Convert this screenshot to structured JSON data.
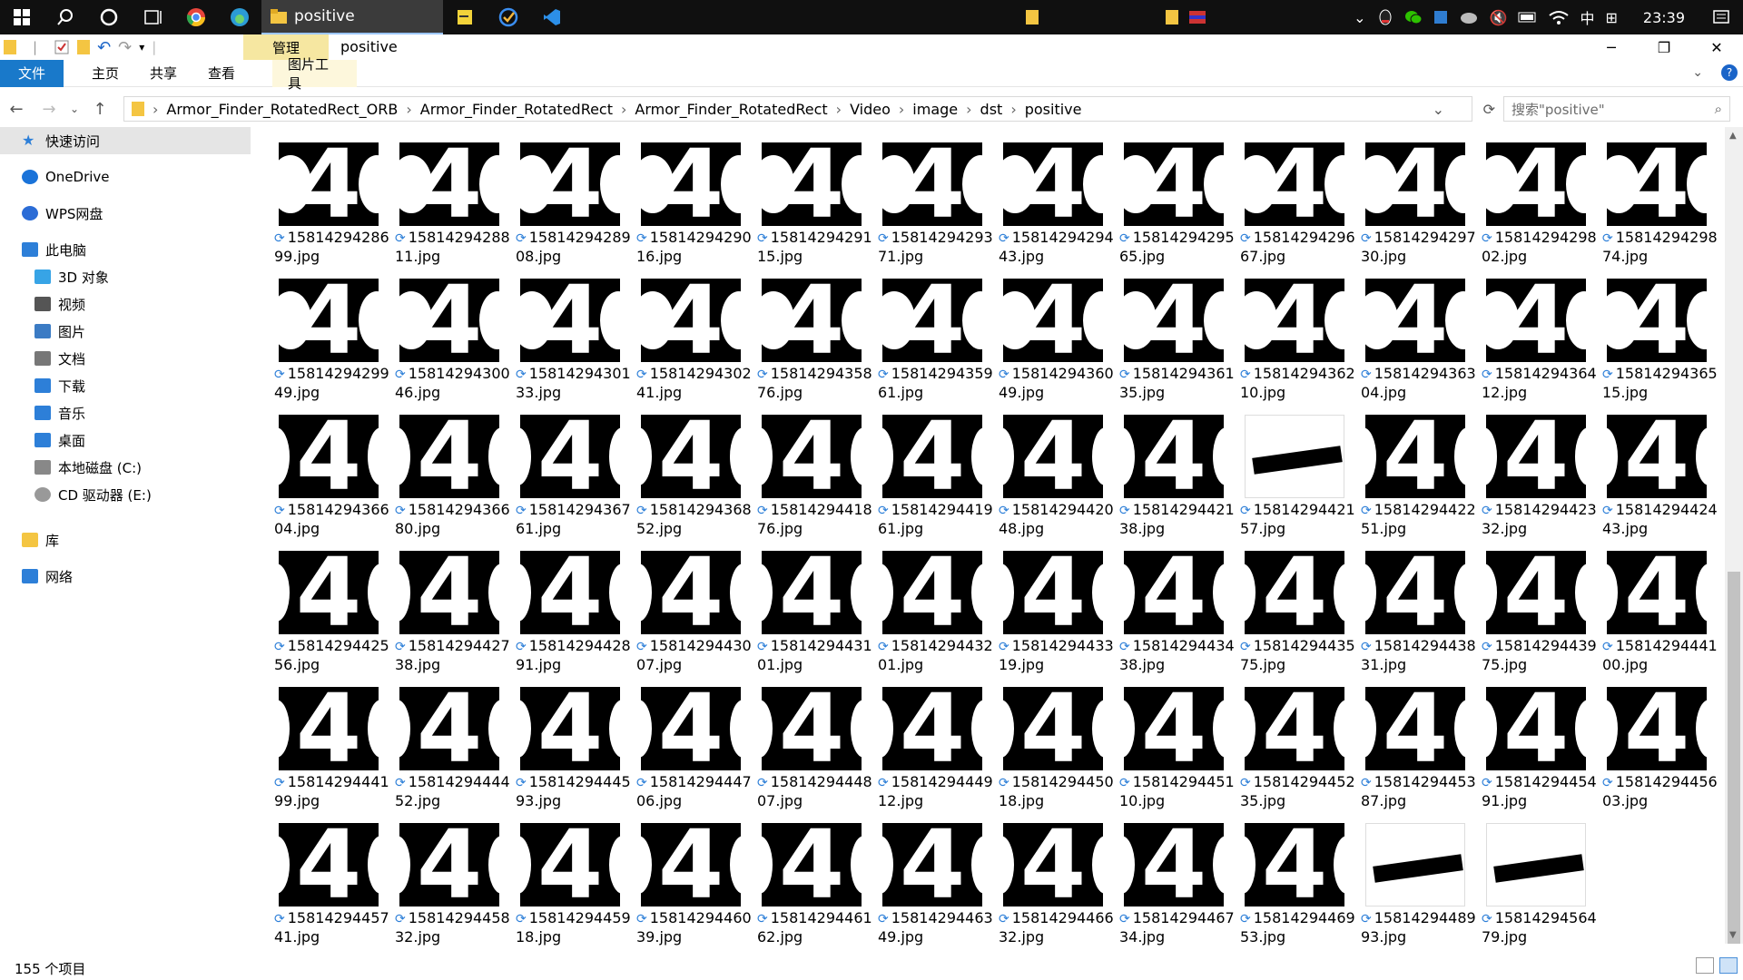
{
  "taskbar": {
    "active_app": "positive",
    "time": "23:39",
    "ime": "中"
  },
  "window": {
    "context_tab": "管理",
    "title": "positive"
  },
  "ribbon": {
    "file": "文件",
    "home": "主页",
    "share": "共享",
    "view": "查看",
    "picture_tools": "图片工具"
  },
  "address": {
    "crumbs": [
      "Armor_Finder_RotatedRect_ORB",
      "Armor_Finder_RotatedRect",
      "Armor_Finder_RotatedRect",
      "Video",
      "image",
      "dst",
      "positive"
    ],
    "search_placeholder": "搜索\"positive\""
  },
  "sidebar": {
    "items": [
      {
        "label": "快速访问",
        "icon": "star-icon",
        "selected": true
      },
      {
        "label": "OneDrive",
        "icon": "cloud-icon"
      },
      {
        "label": "WPS网盘",
        "icon": "cloud-outline-icon"
      },
      {
        "label": "此电脑",
        "icon": "computer-icon"
      },
      {
        "label": "3D 对象",
        "icon": "cube-icon"
      },
      {
        "label": "视频",
        "icon": "video-icon"
      },
      {
        "label": "图片",
        "icon": "picture-icon"
      },
      {
        "label": "文档",
        "icon": "document-icon"
      },
      {
        "label": "下载",
        "icon": "download-icon"
      },
      {
        "label": "音乐",
        "icon": "music-icon"
      },
      {
        "label": "桌面",
        "icon": "desktop-icon"
      },
      {
        "label": "本地磁盘 (C:)",
        "icon": "disk-icon"
      },
      {
        "label": "CD 驱动器 (E:)",
        "icon": "cd-icon"
      },
      {
        "label": "库",
        "icon": "library-icon"
      },
      {
        "label": "网络",
        "icon": "network-icon"
      }
    ]
  },
  "files": [
    [
      "1581429428699.jpg",
      "1581429428811.jpg",
      "1581429428908.jpg",
      "1581429429016.jpg",
      "1581429429115.jpg",
      "1581429429371.jpg",
      "1581429429443.jpg",
      "1581429429565.jpg",
      "1581429429667.jpg",
      "1581429429730.jpg",
      "1581429429802.jpg",
      "1581429429874.jpg"
    ],
    [
      "1581429429949.jpg",
      "1581429430046.jpg",
      "1581429430133.jpg",
      "1581429430241.jpg",
      "1581429435876.jpg",
      "1581429435961.jpg",
      "1581429436049.jpg",
      "1581429436135.jpg",
      "1581429436210.jpg",
      "1581429436304.jpg",
      "1581429436412.jpg",
      "1581429436515.jpg"
    ],
    [
      "1581429436604.jpg",
      "1581429436680.jpg",
      "1581429436761.jpg",
      "1581429436852.jpg",
      "1581429441876.jpg",
      "1581429441961.jpg",
      "1581429442048.jpg",
      "1581429442138.jpg",
      "1581429442157.jpg",
      "1581429442251.jpg",
      "1581429442332.jpg",
      "1581429442443.jpg"
    ],
    [
      "1581429442556.jpg",
      "1581429442738.jpg",
      "1581429442891.jpg",
      "1581429443007.jpg",
      "1581429443101.jpg",
      "1581429443201.jpg",
      "1581429443319.jpg",
      "1581429443438.jpg",
      "1581429443575.jpg",
      "1581429443831.jpg",
      "1581429443975.jpg",
      "1581429444100.jpg"
    ],
    [
      "1581429444199.jpg",
      "1581429444452.jpg",
      "1581429444593.jpg",
      "1581429444706.jpg",
      "1581429444807.jpg",
      "1581429444912.jpg",
      "1581429445018.jpg",
      "1581429445110.jpg",
      "1581429445235.jpg",
      "1581429445387.jpg",
      "1581429445491.jpg",
      "1581429445603.jpg"
    ],
    [
      "1581429445741.jpg",
      "1581429445832.jpg",
      "1581429445918.jpg",
      "1581429446039.jpg",
      "1581429446162.jpg",
      "1581429446349.jpg",
      "1581429446632.jpg",
      "1581429446734.jpg",
      "1581429446953.jpg",
      "1581429448993.jpg",
      "1581429456479.jpg"
    ]
  ],
  "white_thumbs": [
    "2-8",
    "5-9",
    "5-10"
  ],
  "status": {
    "count": "155 个项目"
  }
}
